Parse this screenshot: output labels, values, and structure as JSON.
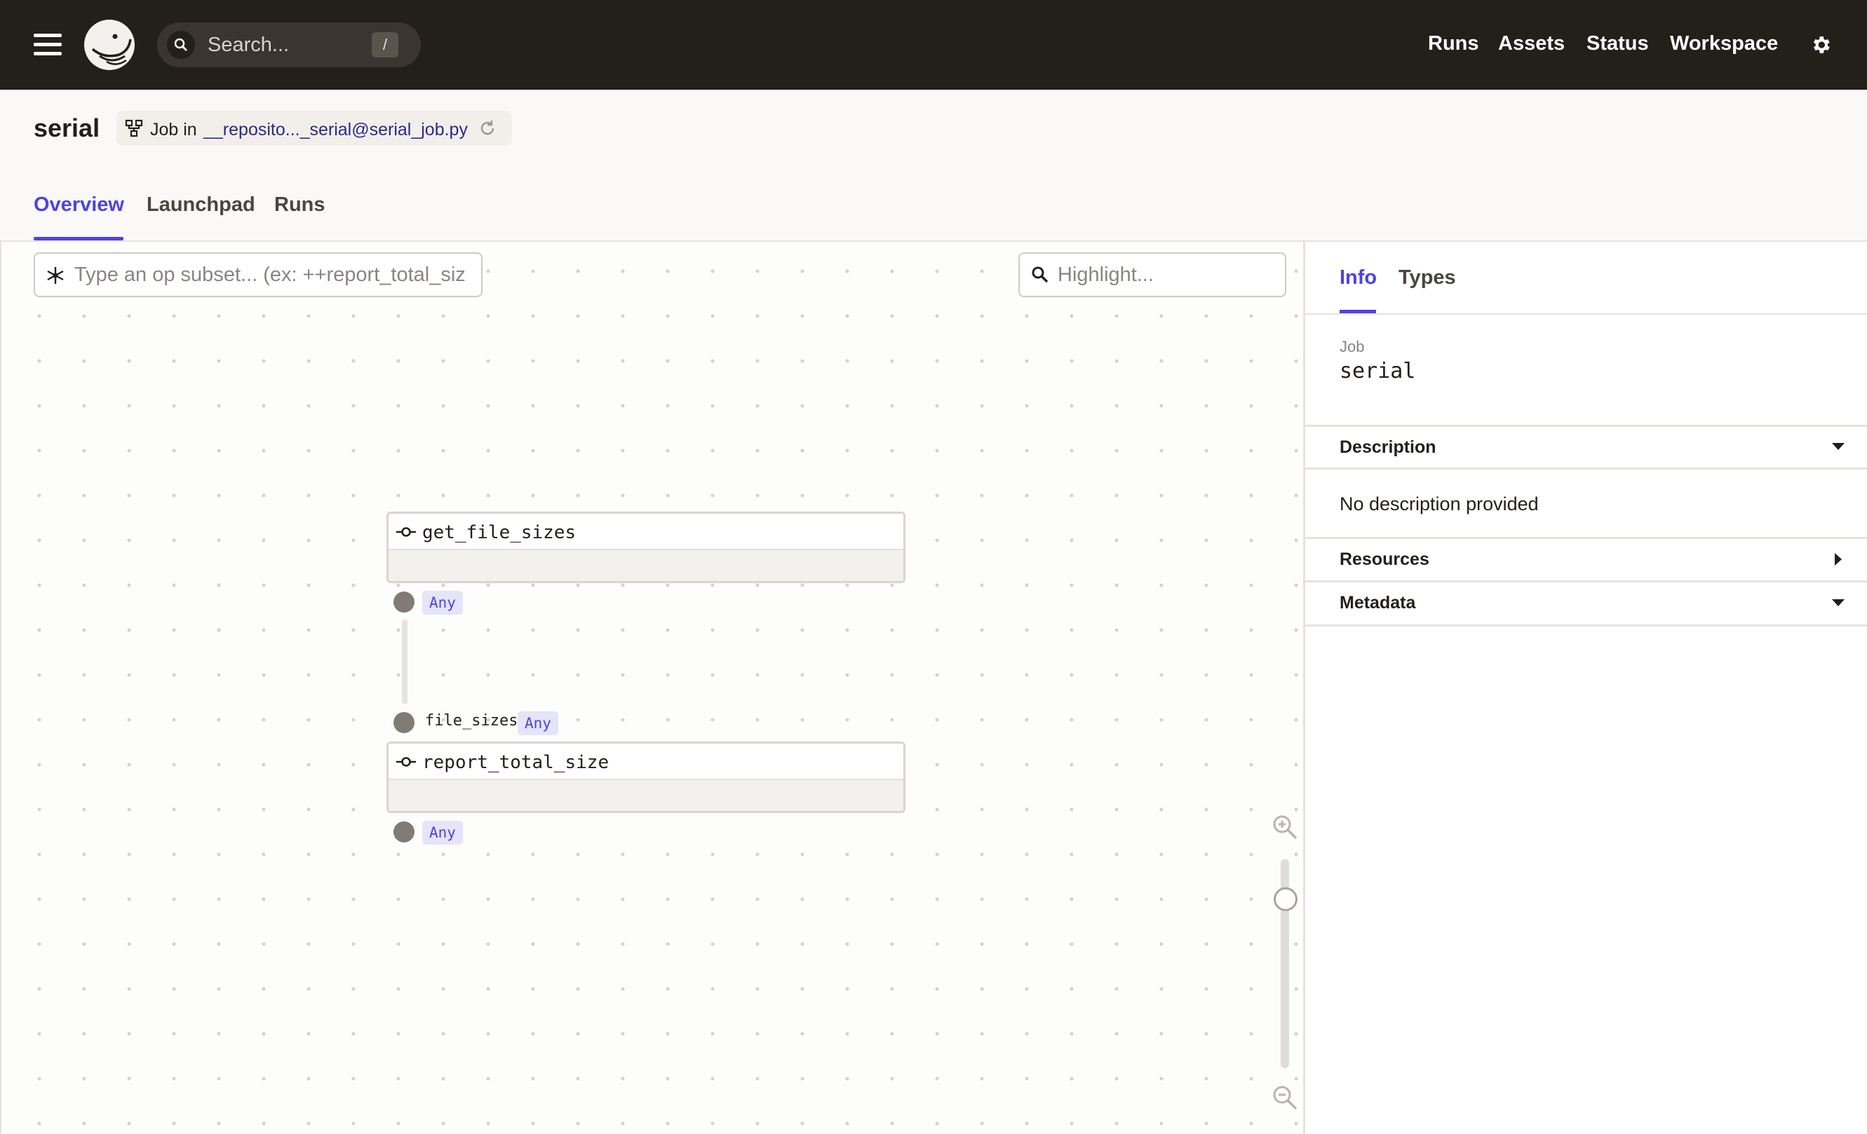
{
  "topbar": {
    "search_placeholder": "Search...",
    "search_shortcut": "/",
    "nav": [
      "Runs",
      "Assets",
      "Status",
      "Workspace"
    ]
  },
  "header": {
    "title": "serial",
    "job_in_label": "Job in",
    "job_location": "__reposito..._serial@serial_job.py",
    "tabs": [
      "Overview",
      "Launchpad",
      "Runs"
    ]
  },
  "graph": {
    "op_subset_placeholder": "Type an op subset... (ex: ++report_total_siz",
    "highlight_placeholder": "Highlight...",
    "ops": [
      {
        "name": "get_file_sizes",
        "output_type": "Any"
      },
      {
        "name": "report_total_size",
        "input_name": "file_sizes",
        "input_type": "Any",
        "output_type": "Any"
      }
    ]
  },
  "sidebar": {
    "tabs": [
      "Info",
      "Types"
    ],
    "job_label": "Job",
    "job_name": "serial",
    "sections": {
      "description": "Description",
      "description_text": "No description provided",
      "resources": "Resources",
      "metadata": "Metadata"
    }
  },
  "colors": {
    "topbar_bg": "#231f1b",
    "accent": "#4f43dd",
    "link": "#2a2a8a",
    "type_tag_bg": "#e5e4f8"
  }
}
